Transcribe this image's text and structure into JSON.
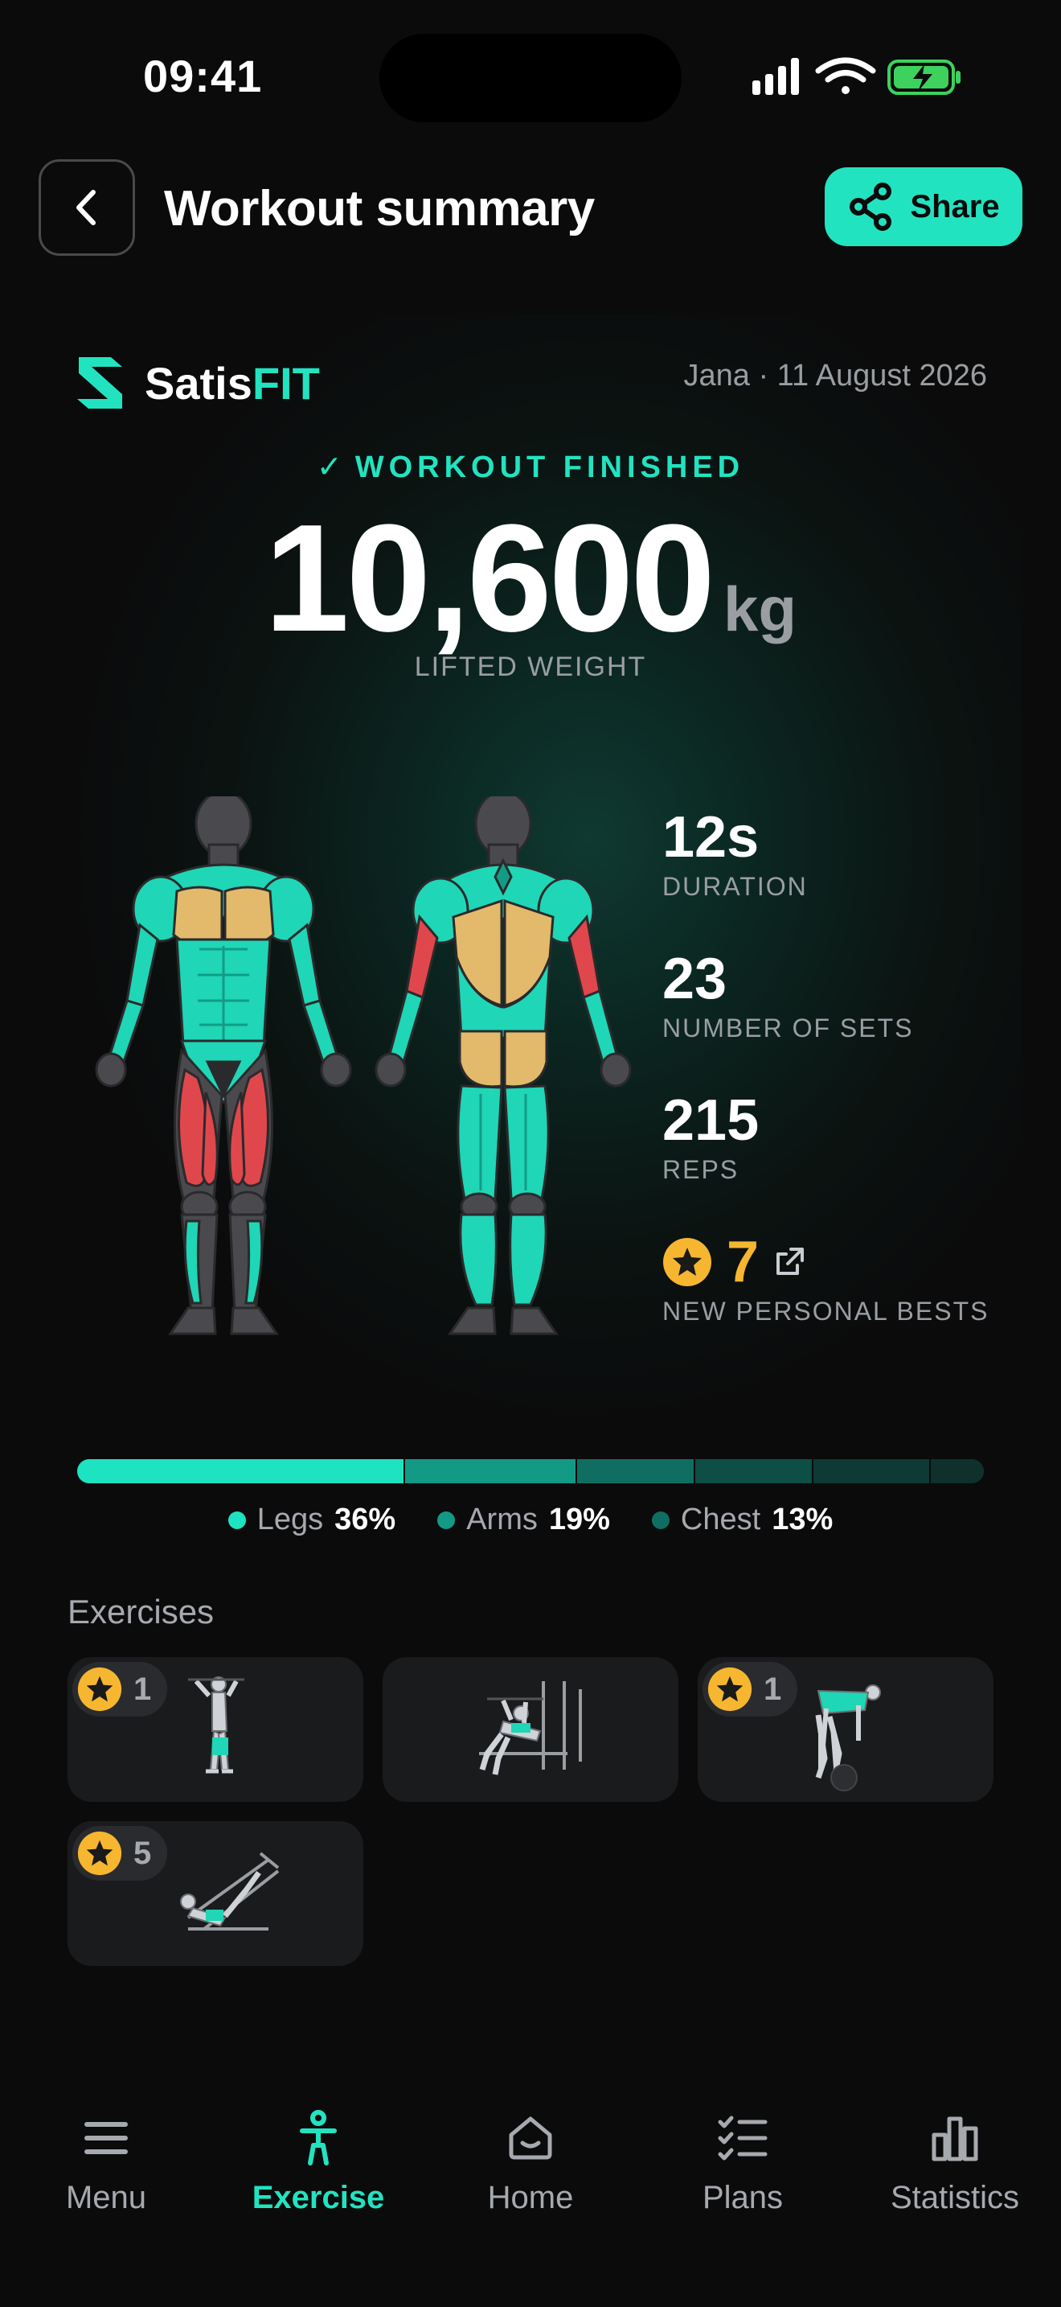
{
  "status_bar": {
    "time": "09:41"
  },
  "header": {
    "title": "Workout summary",
    "share_label": "Share"
  },
  "card": {
    "brand_prefix": "Satis",
    "brand_suffix": "FIT",
    "user_date": "Jana · 11 August 2026",
    "finished_label": "WORKOUT FINISHED",
    "weight_value": "10,600",
    "weight_unit": "kg",
    "weight_label": "LIFTED WEIGHT",
    "stats": {
      "duration": {
        "value": "12s",
        "label": "DURATION"
      },
      "sets": {
        "value": "23",
        "label": "NUMBER OF SETS"
      },
      "reps": {
        "value": "215",
        "label": "REPS"
      },
      "personal_bests": {
        "value": "7",
        "label": "NEW PERSONAL BESTS"
      }
    }
  },
  "distribution": {
    "segments": [
      {
        "name": "Legs",
        "percent": 36,
        "color": "#1ee3c0"
      },
      {
        "name": "Arms",
        "percent": 19,
        "color": "#139a86"
      },
      {
        "name": "Chest",
        "percent": 13,
        "color": "#0f6e61"
      },
      {
        "name": "",
        "percent": 13,
        "color": "#0d4e46"
      },
      {
        "name": "",
        "percent": 13,
        "color": "#0d3a35"
      },
      {
        "name": "",
        "percent": 6,
        "color": "#10302c"
      }
    ],
    "legend": [
      {
        "name": "Legs",
        "pct": "36%",
        "color": "#1ee3c0"
      },
      {
        "name": "Arms",
        "pct": "19%",
        "color": "#139a86"
      },
      {
        "name": "Chest",
        "pct": "13%",
        "color": "#0f6e61"
      }
    ]
  },
  "exercises": {
    "title": "Exercises",
    "items": [
      {
        "badge": "1",
        "figure": "standing-raise-figure"
      },
      {
        "badge": null,
        "figure": "bench-press-figure"
      },
      {
        "badge": "1",
        "figure": "bent-over-row-figure"
      },
      {
        "badge": "5",
        "figure": "leg-press-figure"
      }
    ]
  },
  "tabbar": {
    "items": [
      {
        "label": "Menu",
        "icon": "menu-icon"
      },
      {
        "label": "Exercise",
        "icon": "exercise-icon",
        "active": true
      },
      {
        "label": "Home",
        "icon": "home-icon"
      },
      {
        "label": "Plans",
        "icon": "plans-icon"
      },
      {
        "label": "Statistics",
        "icon": "statistics-icon"
      }
    ]
  },
  "colors": {
    "accent": "#22e3c0",
    "gold": "#f6b630",
    "muscle_teal": "#1fd6b6",
    "muscle_red": "#e0474c",
    "muscle_tan": "#e3b96b"
  }
}
